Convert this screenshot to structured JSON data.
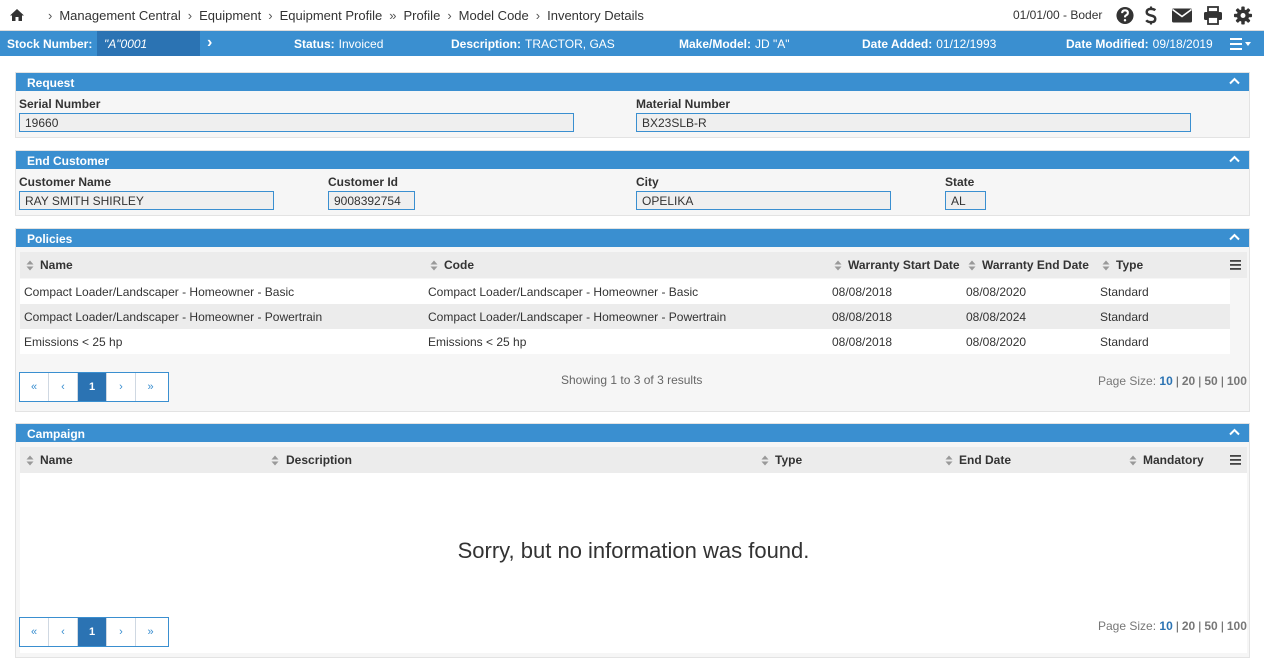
{
  "nav": {
    "breadcrumbs": [
      "Management Central",
      "Equipment",
      "Equipment Profile",
      "Profile",
      "Model Code",
      "Inventory Details"
    ],
    "separators": [
      "›",
      "›",
      "»",
      "›",
      "›"
    ],
    "user_info": "01/01/00 - Boder",
    "icons": [
      "home-icon",
      "help-icon",
      "dollar-icon",
      "mail-icon",
      "print-icon",
      "gear-icon"
    ]
  },
  "stockbar": {
    "stock_label": "Stock Number:",
    "stock_value": "\"A\"0001",
    "arrow": "›",
    "status_label": "Status:",
    "status_value": "Invoiced",
    "description_label": "Description:",
    "description_value": "TRACTOR, GAS",
    "makemodel_label": "Make/Model:",
    "makemodel_value": "JD \"A\"",
    "date_added_label": "Date Added:",
    "date_added_value": "01/12/1993",
    "date_modified_label": "Date Modified:",
    "date_modified_value": "09/18/2019"
  },
  "request": {
    "title": "Request",
    "serial_label": "Serial Number",
    "serial_value": "19660",
    "material_label": "Material Number",
    "material_value": "BX23SLB-R"
  },
  "end_customer": {
    "title": "End Customer",
    "name_label": "Customer Name",
    "name_value": "RAY SMITH SHIRLEY",
    "id_label": "Customer Id",
    "id_value": "9008392754",
    "city_label": "City",
    "city_value": "OPELIKA",
    "state_label": "State",
    "state_value": "AL"
  },
  "policies": {
    "title": "Policies",
    "columns": [
      "Name",
      "Code",
      "Warranty Start Date",
      "Warranty End Date",
      "Type"
    ],
    "rows": [
      [
        "Compact Loader/Landscaper - Homeowner - Basic",
        "Compact Loader/Landscaper - Homeowner - Basic",
        "08/08/2018",
        "08/08/2020",
        "Standard"
      ],
      [
        "Compact Loader/Landscaper - Homeowner - Powertrain",
        "Compact Loader/Landscaper - Homeowner - Powertrain",
        "08/08/2018",
        "08/08/2024",
        "Standard"
      ],
      [
        "Emissions < 25 hp",
        "Emissions < 25 hp",
        "08/08/2018",
        "08/08/2020",
        "Standard"
      ]
    ],
    "pager": [
      "«",
      "‹",
      "1",
      "›",
      "»"
    ],
    "showing": "Showing 1 to 3 of 3 results",
    "page_size_label": "Page Size:",
    "page_sizes": [
      "10",
      "20",
      "50",
      "100"
    ]
  },
  "campaign": {
    "title": "Campaign",
    "columns": [
      "Name",
      "Description",
      "Type",
      "End Date",
      "Mandatory"
    ],
    "empty_message": "Sorry, but no information was found.",
    "pager": [
      "«",
      "‹",
      "1",
      "›",
      "»"
    ],
    "page_size_label": "Page Size:",
    "page_sizes": [
      "10",
      "20",
      "50",
      "100"
    ]
  },
  "colors": {
    "accent": "#3a8fd0",
    "accent_dark": "#2b73b3"
  }
}
